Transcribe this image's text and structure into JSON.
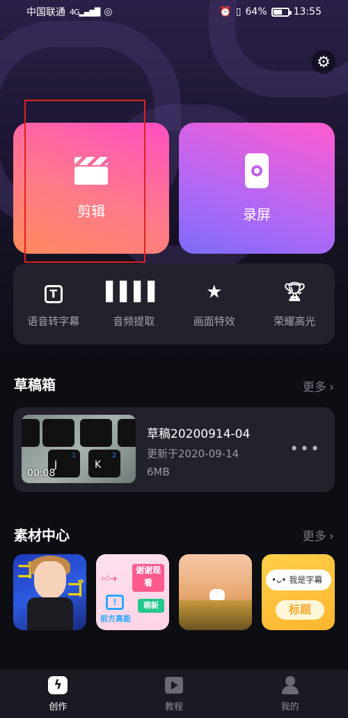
{
  "status_bar": {
    "carrier": "中国联通",
    "network": "4G",
    "battery": "64%",
    "battery_level": 0.64,
    "time": "13:55"
  },
  "main_cards": {
    "edit_label": "剪辑",
    "record_label": "录屏"
  },
  "tools": [
    {
      "label": "语音转字幕",
      "icon": "subtitle-t-icon"
    },
    {
      "label": "音频提取",
      "icon": "audio-wave-icon"
    },
    {
      "label": "画面特效",
      "icon": "magic-star-icon"
    },
    {
      "label": "荣耀高光",
      "icon": "trophy-icon"
    }
  ],
  "drafts": {
    "title": "草稿箱",
    "more": "更多",
    "item": {
      "name": "草稿20200914-04",
      "updated": "更新于2020-09-14",
      "size": "6MB",
      "duration": "00:08",
      "keys": [
        "J",
        "K"
      ],
      "key_numbers": [
        "1",
        "2"
      ]
    }
  },
  "materials": {
    "title": "素材中心",
    "more": "更多",
    "thumb2": {
      "tag": "谢谢观看",
      "caption": "前方高能",
      "button": "萌新"
    },
    "thumb4": {
      "bubble": "•ᴗ• 我是字幕",
      "title": "标题"
    }
  },
  "tabbar": {
    "tabs": [
      {
        "label": "创作",
        "active": true
      },
      {
        "label": "教程",
        "active": false
      },
      {
        "label": "我的",
        "active": false
      }
    ]
  },
  "colors": {
    "highlight": "#e0221f",
    "edit_gradient": "#ff7a8a",
    "record_gradient": "#b268f5"
  }
}
